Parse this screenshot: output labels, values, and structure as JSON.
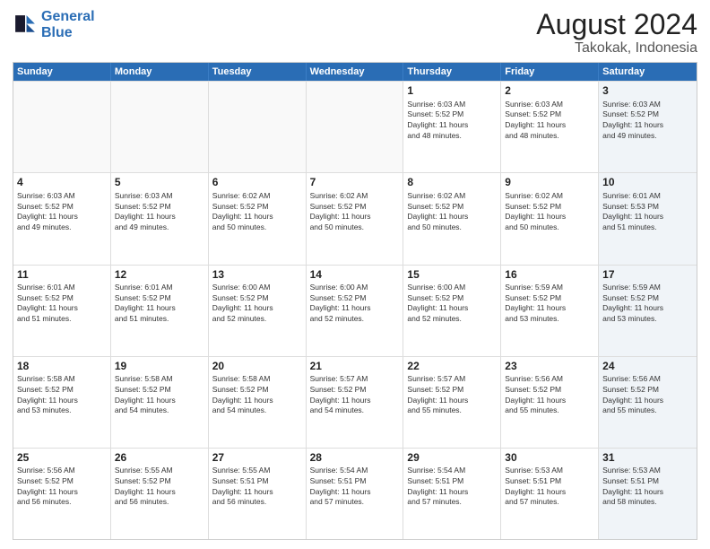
{
  "logo": {
    "line1": "General",
    "line2": "Blue"
  },
  "title": "August 2024",
  "subtitle": "Takokak, Indonesia",
  "days": [
    "Sunday",
    "Monday",
    "Tuesday",
    "Wednesday",
    "Thursday",
    "Friday",
    "Saturday"
  ],
  "weeks": [
    [
      {
        "day": "",
        "empty": true
      },
      {
        "day": "",
        "empty": true
      },
      {
        "day": "",
        "empty": true
      },
      {
        "day": "",
        "empty": true
      },
      {
        "day": "1",
        "line1": "Sunrise: 6:03 AM",
        "line2": "Sunset: 5:52 PM",
        "line3": "Daylight: 11 hours",
        "line4": "and 48 minutes."
      },
      {
        "day": "2",
        "line1": "Sunrise: 6:03 AM",
        "line2": "Sunset: 5:52 PM",
        "line3": "Daylight: 11 hours",
        "line4": "and 48 minutes."
      },
      {
        "day": "3",
        "line1": "Sunrise: 6:03 AM",
        "line2": "Sunset: 5:52 PM",
        "line3": "Daylight: 11 hours",
        "line4": "and 49 minutes.",
        "shaded": true
      }
    ],
    [
      {
        "day": "4",
        "line1": "Sunrise: 6:03 AM",
        "line2": "Sunset: 5:52 PM",
        "line3": "Daylight: 11 hours",
        "line4": "and 49 minutes."
      },
      {
        "day": "5",
        "line1": "Sunrise: 6:03 AM",
        "line2": "Sunset: 5:52 PM",
        "line3": "Daylight: 11 hours",
        "line4": "and 49 minutes."
      },
      {
        "day": "6",
        "line1": "Sunrise: 6:02 AM",
        "line2": "Sunset: 5:52 PM",
        "line3": "Daylight: 11 hours",
        "line4": "and 50 minutes."
      },
      {
        "day": "7",
        "line1": "Sunrise: 6:02 AM",
        "line2": "Sunset: 5:52 PM",
        "line3": "Daylight: 11 hours",
        "line4": "and 50 minutes."
      },
      {
        "day": "8",
        "line1": "Sunrise: 6:02 AM",
        "line2": "Sunset: 5:52 PM",
        "line3": "Daylight: 11 hours",
        "line4": "and 50 minutes."
      },
      {
        "day": "9",
        "line1": "Sunrise: 6:02 AM",
        "line2": "Sunset: 5:52 PM",
        "line3": "Daylight: 11 hours",
        "line4": "and 50 minutes."
      },
      {
        "day": "10",
        "line1": "Sunrise: 6:01 AM",
        "line2": "Sunset: 5:53 PM",
        "line3": "Daylight: 11 hours",
        "line4": "and 51 minutes.",
        "shaded": true
      }
    ],
    [
      {
        "day": "11",
        "line1": "Sunrise: 6:01 AM",
        "line2": "Sunset: 5:52 PM",
        "line3": "Daylight: 11 hours",
        "line4": "and 51 minutes."
      },
      {
        "day": "12",
        "line1": "Sunrise: 6:01 AM",
        "line2": "Sunset: 5:52 PM",
        "line3": "Daylight: 11 hours",
        "line4": "and 51 minutes."
      },
      {
        "day": "13",
        "line1": "Sunrise: 6:00 AM",
        "line2": "Sunset: 5:52 PM",
        "line3": "Daylight: 11 hours",
        "line4": "and 52 minutes."
      },
      {
        "day": "14",
        "line1": "Sunrise: 6:00 AM",
        "line2": "Sunset: 5:52 PM",
        "line3": "Daylight: 11 hours",
        "line4": "and 52 minutes."
      },
      {
        "day": "15",
        "line1": "Sunrise: 6:00 AM",
        "line2": "Sunset: 5:52 PM",
        "line3": "Daylight: 11 hours",
        "line4": "and 52 minutes."
      },
      {
        "day": "16",
        "line1": "Sunrise: 5:59 AM",
        "line2": "Sunset: 5:52 PM",
        "line3": "Daylight: 11 hours",
        "line4": "and 53 minutes."
      },
      {
        "day": "17",
        "line1": "Sunrise: 5:59 AM",
        "line2": "Sunset: 5:52 PM",
        "line3": "Daylight: 11 hours",
        "line4": "and 53 minutes.",
        "shaded": true
      }
    ],
    [
      {
        "day": "18",
        "line1": "Sunrise: 5:58 AM",
        "line2": "Sunset: 5:52 PM",
        "line3": "Daylight: 11 hours",
        "line4": "and 53 minutes."
      },
      {
        "day": "19",
        "line1": "Sunrise: 5:58 AM",
        "line2": "Sunset: 5:52 PM",
        "line3": "Daylight: 11 hours",
        "line4": "and 54 minutes."
      },
      {
        "day": "20",
        "line1": "Sunrise: 5:58 AM",
        "line2": "Sunset: 5:52 PM",
        "line3": "Daylight: 11 hours",
        "line4": "and 54 minutes."
      },
      {
        "day": "21",
        "line1": "Sunrise: 5:57 AM",
        "line2": "Sunset: 5:52 PM",
        "line3": "Daylight: 11 hours",
        "line4": "and 54 minutes."
      },
      {
        "day": "22",
        "line1": "Sunrise: 5:57 AM",
        "line2": "Sunset: 5:52 PM",
        "line3": "Daylight: 11 hours",
        "line4": "and 55 minutes."
      },
      {
        "day": "23",
        "line1": "Sunrise: 5:56 AM",
        "line2": "Sunset: 5:52 PM",
        "line3": "Daylight: 11 hours",
        "line4": "and 55 minutes."
      },
      {
        "day": "24",
        "line1": "Sunrise: 5:56 AM",
        "line2": "Sunset: 5:52 PM",
        "line3": "Daylight: 11 hours",
        "line4": "and 55 minutes.",
        "shaded": true
      }
    ],
    [
      {
        "day": "25",
        "line1": "Sunrise: 5:56 AM",
        "line2": "Sunset: 5:52 PM",
        "line3": "Daylight: 11 hours",
        "line4": "and 56 minutes."
      },
      {
        "day": "26",
        "line1": "Sunrise: 5:55 AM",
        "line2": "Sunset: 5:52 PM",
        "line3": "Daylight: 11 hours",
        "line4": "and 56 minutes."
      },
      {
        "day": "27",
        "line1": "Sunrise: 5:55 AM",
        "line2": "Sunset: 5:51 PM",
        "line3": "Daylight: 11 hours",
        "line4": "and 56 minutes."
      },
      {
        "day": "28",
        "line1": "Sunrise: 5:54 AM",
        "line2": "Sunset: 5:51 PM",
        "line3": "Daylight: 11 hours",
        "line4": "and 57 minutes."
      },
      {
        "day": "29",
        "line1": "Sunrise: 5:54 AM",
        "line2": "Sunset: 5:51 PM",
        "line3": "Daylight: 11 hours",
        "line4": "and 57 minutes."
      },
      {
        "day": "30",
        "line1": "Sunrise: 5:53 AM",
        "line2": "Sunset: 5:51 PM",
        "line3": "Daylight: 11 hours",
        "line4": "and 57 minutes."
      },
      {
        "day": "31",
        "line1": "Sunrise: 5:53 AM",
        "line2": "Sunset: 5:51 PM",
        "line3": "Daylight: 11 hours",
        "line4": "and 58 minutes.",
        "shaded": true
      }
    ]
  ]
}
